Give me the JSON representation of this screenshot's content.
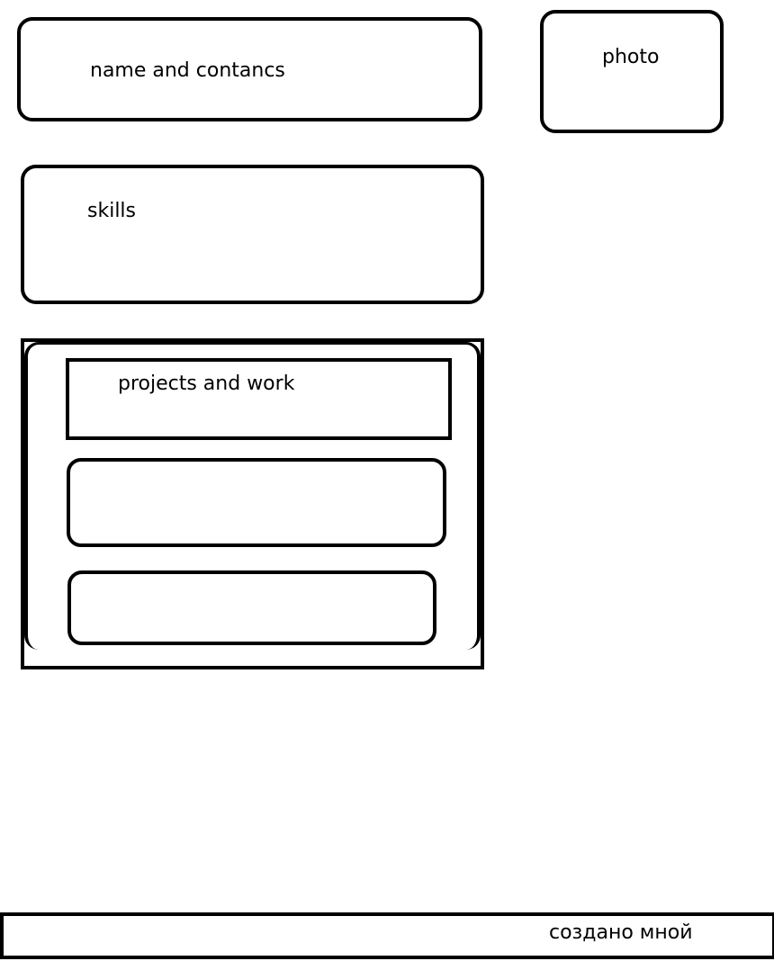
{
  "blocks": {
    "name_contacts": "name and contancs",
    "photo": "photo",
    "skills": "skills",
    "projects": "projects and work"
  },
  "footer": {
    "text": "создано мной"
  }
}
